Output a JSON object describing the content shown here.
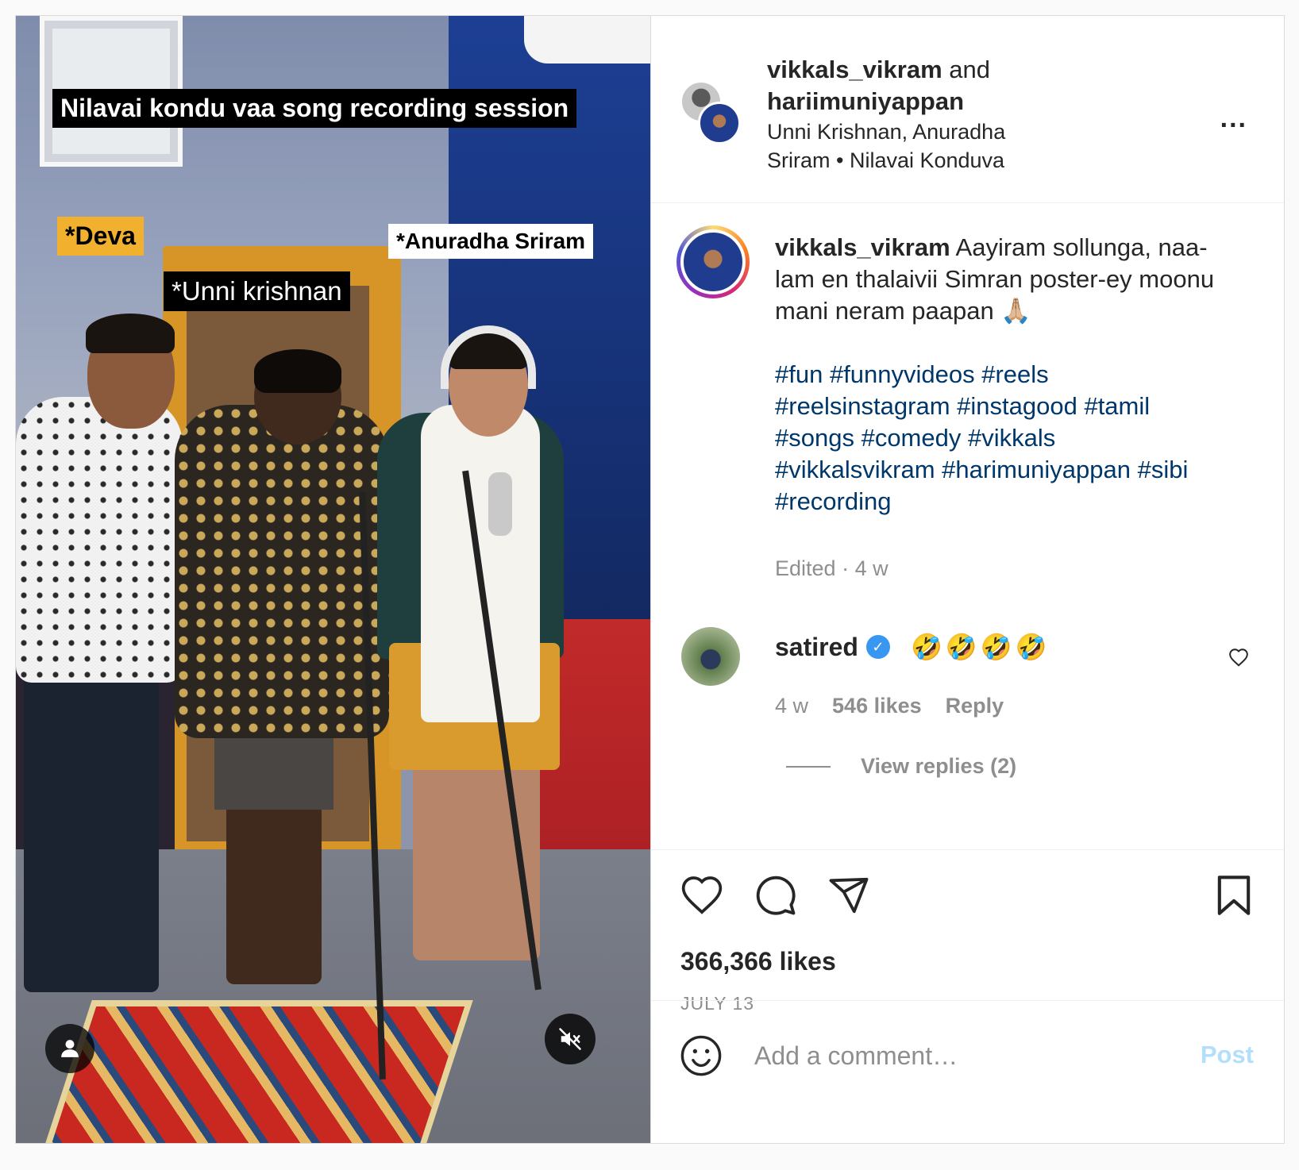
{
  "video": {
    "overlay_title": "Nilavai kondu vaa song recording session",
    "tags": [
      "*Deva",
      "*Unni krishnan",
      "*Anuradha Sriram"
    ],
    "user_icon": "person-icon",
    "mute_icon": "speaker-muted-icon"
  },
  "header": {
    "user1": "vikkals_vikram",
    "and_text": "and",
    "user2": "hariimuniyappan",
    "audio_line1": "Unni Krishnan, Anuradha",
    "audio_line2": "Sriram • Nilavai Konduva",
    "more_label": "..."
  },
  "caption": {
    "username": "vikkals_vikram",
    "text": "Aayiram sollunga, naa-lam en thalaivii Simran poster-ey moonu mani neram paapan 🙏🏼",
    "hashtags": "#fun #funnyvideos #reels #reelsinstagram #instagood #tamil #songs #comedy #vikkals #vikkalsvikram #harimuniyappan #sibi #recording",
    "edited": "Edited",
    "time": "4 w"
  },
  "comment": {
    "username": "satired",
    "verified_icon": "verified-badge-icon",
    "text": "🤣🤣🤣🤣",
    "time": "4 w",
    "likes": "546 likes",
    "reply": "Reply",
    "view_replies": "View replies (2)"
  },
  "actions": {
    "icons": [
      "heart-icon",
      "comment-icon",
      "share-icon",
      "bookmark-icon"
    ]
  },
  "stats": {
    "likes": "366,366 likes",
    "date": "JULY 13"
  },
  "add_comment": {
    "placeholder": "Add a comment…",
    "post_label": "Post"
  },
  "colors": {
    "link": "#00376b",
    "secondary_text": "#8e8e8e",
    "post_disabled": "#b2dffc",
    "border": "#dbdbdb"
  }
}
